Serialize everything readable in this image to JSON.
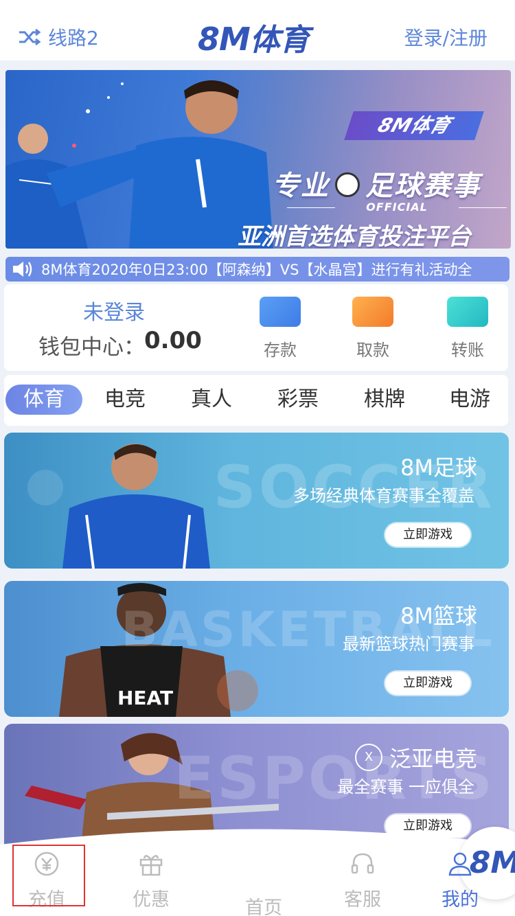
{
  "header": {
    "line_label": "线路2",
    "logo_main": "8M",
    "logo_sub": "体育",
    "auth_label": "登录/注册"
  },
  "banner": {
    "badge": "8M体育",
    "title_left": "专业",
    "title_right": "足球赛事",
    "official": "OFFICIAL",
    "subtitle": "亚洲首选体育投注平台"
  },
  "marquee": {
    "text": "8M体育2020年0日23:00【阿森纳】VS【水晶宫】进行有礼活动全"
  },
  "wallet": {
    "status": "未登录",
    "balance_label": "钱包中心：",
    "balance_value": "0.00",
    "actions": [
      {
        "label": "存款",
        "icon": "deposit-card-icon",
        "color": "#4b8ef0"
      },
      {
        "label": "取款",
        "icon": "withdraw-card-icon",
        "color": "#f59a3a"
      },
      {
        "label": "转账",
        "icon": "transfer-wallet-icon",
        "color": "#36cfc9"
      }
    ]
  },
  "tabs": [
    {
      "label": "体育",
      "active": true
    },
    {
      "label": "电竞"
    },
    {
      "label": "真人"
    },
    {
      "label": "彩票"
    },
    {
      "label": "棋牌"
    },
    {
      "label": "电游"
    }
  ],
  "cards": [
    {
      "title": "8M足球",
      "desc": "多场经典体育赛事全覆盖",
      "button": "立即游戏",
      "watermark": "SOCCER"
    },
    {
      "title": "8M篮球",
      "desc": "最新篮球热门赛事",
      "button": "立即游戏",
      "watermark": "BASKETBALL"
    },
    {
      "title": "泛亚电竞",
      "desc": "最全赛事 一应俱全",
      "button": "立即游戏",
      "watermark": "ESPORTS",
      "seal": "X"
    }
  ],
  "nav": {
    "items": [
      {
        "label": "充值",
        "icon": "recharge-icon"
      },
      {
        "label": "优惠",
        "icon": "gift-icon"
      },
      {
        "label": "首页",
        "icon": "home-logo"
      },
      {
        "label": "客服",
        "icon": "headset-icon"
      },
      {
        "label": "我的",
        "icon": "user-icon",
        "active": true
      }
    ],
    "home_logo": "8M"
  },
  "colors": {
    "accent": "#4a72d8",
    "link": "#5c86d8",
    "inactive": "#bbbbbb",
    "highlight": "#dd3333"
  }
}
